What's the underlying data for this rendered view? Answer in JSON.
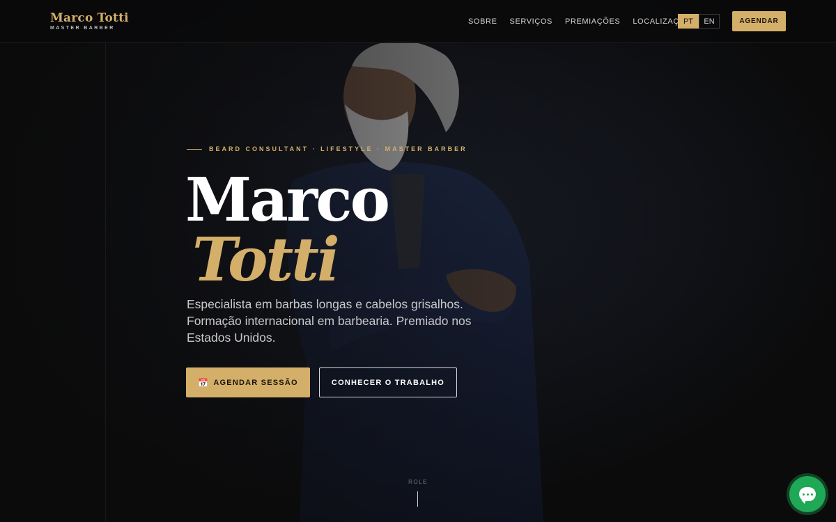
{
  "header": {
    "brand_name": "Marco Totti",
    "brand_sub": "MASTER BARBER",
    "nav": [
      "SOBRE",
      "SERVIÇOS",
      "PREMIAÇÕES",
      "LOCALIZAÇÃO"
    ],
    "languages": [
      "PT",
      "EN"
    ],
    "active_language": "PT",
    "cta": "AGENDAR"
  },
  "hero": {
    "eyebrow": "BEARD CONSULTANT · LIFESTYLE · MASTER BARBER",
    "title_line1": "Marco",
    "title_line2": "Totti",
    "lead": "Especialista em barbas longas e cabelos grisalhos. Formação internacional em barbearia. Premiado nos Estados Unidos.",
    "primary_button": "AGENDAR SESSÃO",
    "primary_button_icon": "calendar-icon",
    "secondary_button": "CONHECER O TRABALHO",
    "scroll_label": "ROLE"
  },
  "chat": {
    "icon": "chat-bubble-icon"
  },
  "colors": {
    "accent": "#d4af6a",
    "background": "#0b0b0c",
    "chat": "#1fa855"
  }
}
